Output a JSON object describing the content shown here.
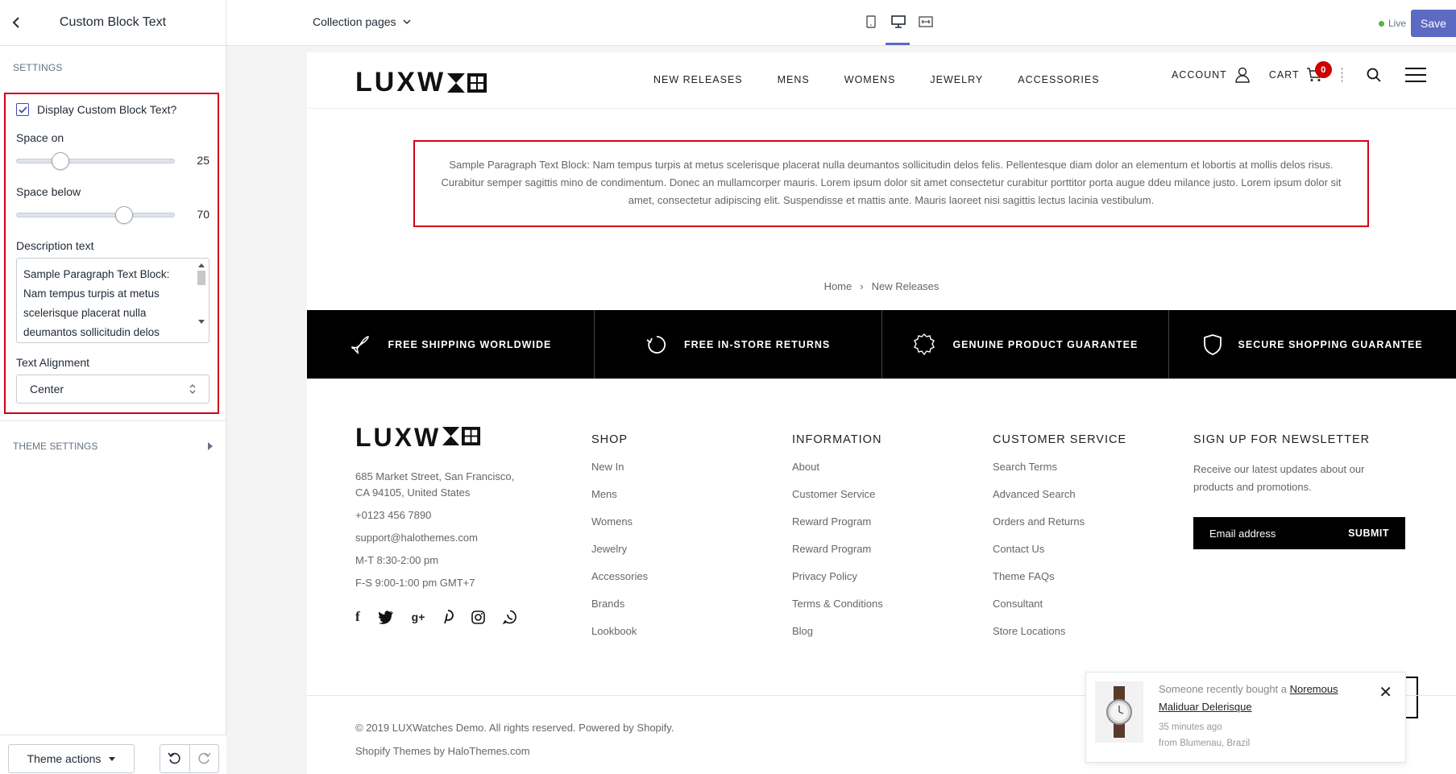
{
  "panel": {
    "title": "Custom Block Text",
    "section_label": "SETTINGS",
    "display_checkbox_label": "Display Custom Block Text?",
    "space_on_label": "Space on",
    "space_on_value": "25",
    "space_on_fraction": 0.25,
    "space_below_label": "Space below",
    "space_below_value": "70",
    "space_below_fraction": 0.7,
    "description_label": "Description text",
    "description_value": "Sample Paragraph Text Block: Nam tempus turpis at metus scelerisque placerat nulla deumantos sollicitudin delos",
    "alignment_label": "Text Alignment",
    "alignment_value": "Center",
    "theme_settings_label": "THEME SETTINGS",
    "theme_actions_label": "Theme actions"
  },
  "topbar": {
    "template_select": "Collection pages",
    "live_label": "Live",
    "save_label": "Save",
    "accent_color": "#5c6ac4"
  },
  "site": {
    "logo": "LUXW",
    "nav": [
      "NEW RELEASES",
      "MENS",
      "WOMENS",
      "JEWELRY",
      "ACCESSORIES"
    ],
    "account_label": "ACCOUNT",
    "cart_label": "CART",
    "cart_count": "0",
    "custom_text": "Sample Paragraph Text Block: Nam tempus turpis at metus scelerisque placerat nulla deumantos sollicitudin delos felis. Pellentesque diam dolor an elementum et lobortis at mollis delos risus. Curabitur semper sagittis mino de condimentum. Donec an mullamcorper mauris. Lorem ipsum dolor sit amet consectetur curabitur porttitor porta augue ddeu milance justo. Lorem ipsum dolor sit amet, consectetur adipiscing elit. Suspendisse et mattis ante. Mauris laoreet nisi sagittis lectus lacinia vestibulum.",
    "breadcrumb_home": "Home",
    "breadcrumb_current": "New Releases",
    "features": [
      "FREE SHIPPING WORLDWIDE",
      "FREE IN-STORE RETURNS",
      "GENUINE PRODUCT GUARANTEE",
      "SECURE SHOPPING GUARANTEE"
    ],
    "highlight_color": "#d0021b"
  },
  "footer": {
    "address_line1": "685 Market Street, San Francisco,",
    "address_line2": "CA 94105, United States",
    "phone": "+0123 456 7890",
    "email": "support@halothemes.com",
    "hours1": "M-T 8:30-2:00 pm",
    "hours2": "F-S 9:00-1:00 pm GMT+7",
    "shop_title": "SHOP",
    "shop_links": [
      "New In",
      "Mens",
      "Womens",
      "Jewelry",
      "Accessories",
      "Brands",
      "Lookbook"
    ],
    "info_title": "INFORMATION",
    "info_links": [
      "About",
      "Customer Service",
      "Reward Program",
      "Reward Program",
      "Privacy Policy",
      "Terms & Conditions",
      "Blog"
    ],
    "cs_title": "CUSTOMER SERVICE",
    "cs_links": [
      "Search Terms",
      "Advanced Search",
      "Orders and Returns",
      "Contact Us",
      "Theme FAQs",
      "Consultant",
      "Store Locations"
    ],
    "newsletter_title": "SIGN UP FOR NEWSLETTER",
    "newsletter_text": "Receive our latest updates about our products and promotions.",
    "newsletter_placeholder": "Email address",
    "newsletter_submit": "SUBMIT",
    "copyright": "© 2019 LUXWatches Demo. All rights reserved. Powered by Shopify.",
    "credits": "Shopify Themes by HaloThemes.com"
  },
  "popup": {
    "text": "Someone recently bought a",
    "product": "Noremous Maliduar Delerisque",
    "time": "35 minutes ago",
    "location": "from Blumenau, Brazil"
  }
}
